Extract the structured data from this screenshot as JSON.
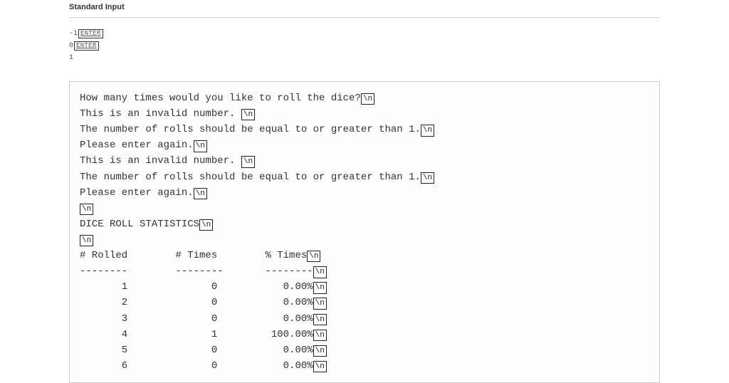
{
  "heading": "Standard Input",
  "input_lines": [
    {
      "text": "-1",
      "enter": true
    },
    {
      "text": "0",
      "enter": true
    },
    {
      "text": "1",
      "enter": false
    }
  ],
  "enter_label": "ENTER",
  "nl_label": "\\n",
  "output_lines": [
    "How many times would you like to roll the dice?",
    "This is an invalid number. ",
    "The number of rolls should be equal to or greater than 1.",
    "Please enter again.",
    "This is an invalid number. ",
    "The number of rolls should be equal to or greater than 1.",
    "Please enter again.",
    "",
    "DICE ROLL STATISTICS",
    "",
    "# Rolled        # Times        % Times",
    "--------        --------       --------",
    "       1              0           0.00%",
    "       2              0           0.00%",
    "       3              0           0.00%",
    "       4              1         100.00%",
    "       5              0           0.00%",
    "       6              0           0.00%"
  ]
}
